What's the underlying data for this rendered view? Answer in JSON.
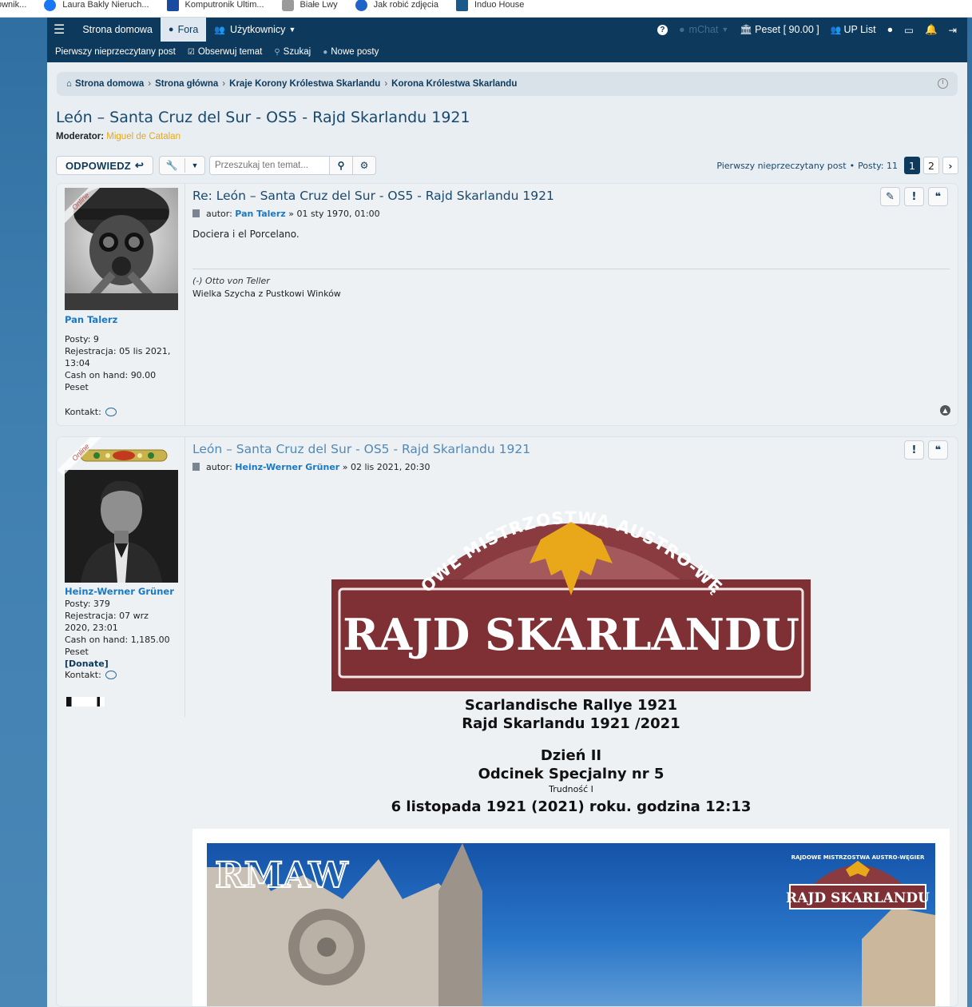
{
  "bookmarks": [
    {
      "label": "ownik...",
      "icon": "none",
      "color": "#ffffff"
    },
    {
      "label": "Laura Bakly Nieruch...",
      "icon": "facebook-icon",
      "color": "#1877f2"
    },
    {
      "label": "Komputronik Ultim...",
      "icon": "star-icon",
      "color": "#1a4aa0"
    },
    {
      "label": "Białe Lwy",
      "icon": "shield-icon",
      "color": "#888888"
    },
    {
      "label": "Jak robić zdjęcia",
      "icon": "m-icon",
      "color": "#1e64c8"
    },
    {
      "label": "Induo House",
      "icon": "building-icon",
      "color": "#1a5a8a"
    }
  ],
  "nav": {
    "home": "Strona domowa",
    "forums": "Fora",
    "users": "Użytkownicy",
    "mchat": "mChat",
    "peset": "Peset [ 90.00 ]",
    "up_list": "UP List"
  },
  "subnav": {
    "first_unread": "Pierwszy nieprzeczytany post",
    "watch": "Obserwuj temat",
    "search": "Szukaj",
    "new_posts": "Nowe posty"
  },
  "breadcrumbs": [
    "Strona domowa",
    "Strona główna",
    "Kraje Korony Królestwa Skarlandu",
    "Korona Królestwa Skarlandu"
  ],
  "topic": {
    "title": "León – Santa Cruz del Sur - OS5 - Rajd Skarlandu 1921",
    "moderator_label": "Moderator:",
    "moderator_name": "Miguel de Catalan"
  },
  "actions": {
    "reply": "ODPOWIEDZ",
    "search_placeholder": "Przeszukaj ten temat...",
    "first_unread": "Pierwszy nieprzeczytany post",
    "posts_count": "Posty: 11",
    "pages": [
      "1",
      "2"
    ],
    "current_page": "1"
  },
  "posts": [
    {
      "online": "Online",
      "username": "Pan Talerz",
      "posts": "Posty: 9",
      "registration": "Rejestracja: 05 lis 2021, 13:04",
      "cash": "Cash on hand: 90.00 Peset",
      "contact": "Kontakt:",
      "title": "Re: León – Santa Cruz del Sur - OS5 - Rajd Skarlandu 1921",
      "author_label": "autor:",
      "author": "Pan Talerz",
      "date": "» 01 sty 1970, 01:00",
      "content": "Dociera i el Porcelano.",
      "sig_line1": "(-) Otto von Teller",
      "sig_line2": "Wielka Szycha z Pustkowi Winków"
    },
    {
      "online": "Online",
      "username": "Heinz-Werner Grüner",
      "posts": "Posty: 379",
      "registration": "Rejestracja: 07 wrz 2020, 23:01",
      "cash": "Cash on hand: 1,185.00 Peset",
      "donate": "[Donate]",
      "contact": "Kontakt:",
      "title": "León – Santa Cruz del Sur - OS5 - Rajd Skarlandu 1921",
      "author_label": "autor:",
      "author": "Heinz-Werner Grüner",
      "date": "» 02 lis 2021, 20:30",
      "logo_arc": "RAJDOWE MISTRZOSTWA AUSTRO-WĘGIER",
      "logo_main": "RAJD SKARLANDU",
      "line1": "Scarlandische Rallye 1921",
      "line2": "Rajd Skarlandu 1921 /2021",
      "line3": "Dzień II",
      "line4": "Odcinek Specjalny nr 5",
      "line5": "Trudność I",
      "line6": "6 listopada 1921 (2021) roku. godzina 12:13",
      "banner_left": "RMAW",
      "banner_right_arc": "RAJDOWE MISTRZOSTWA AUSTRO-WĘGIER",
      "banner_right": "RAJD SKARLANDU"
    }
  ],
  "colors": {
    "navbar": "#0d3a5c",
    "username": "#1a79c2",
    "moderator": "#e8a81a",
    "logo_maroon": "#8a3b3f",
    "eagle_gold": "#e8a81a"
  }
}
